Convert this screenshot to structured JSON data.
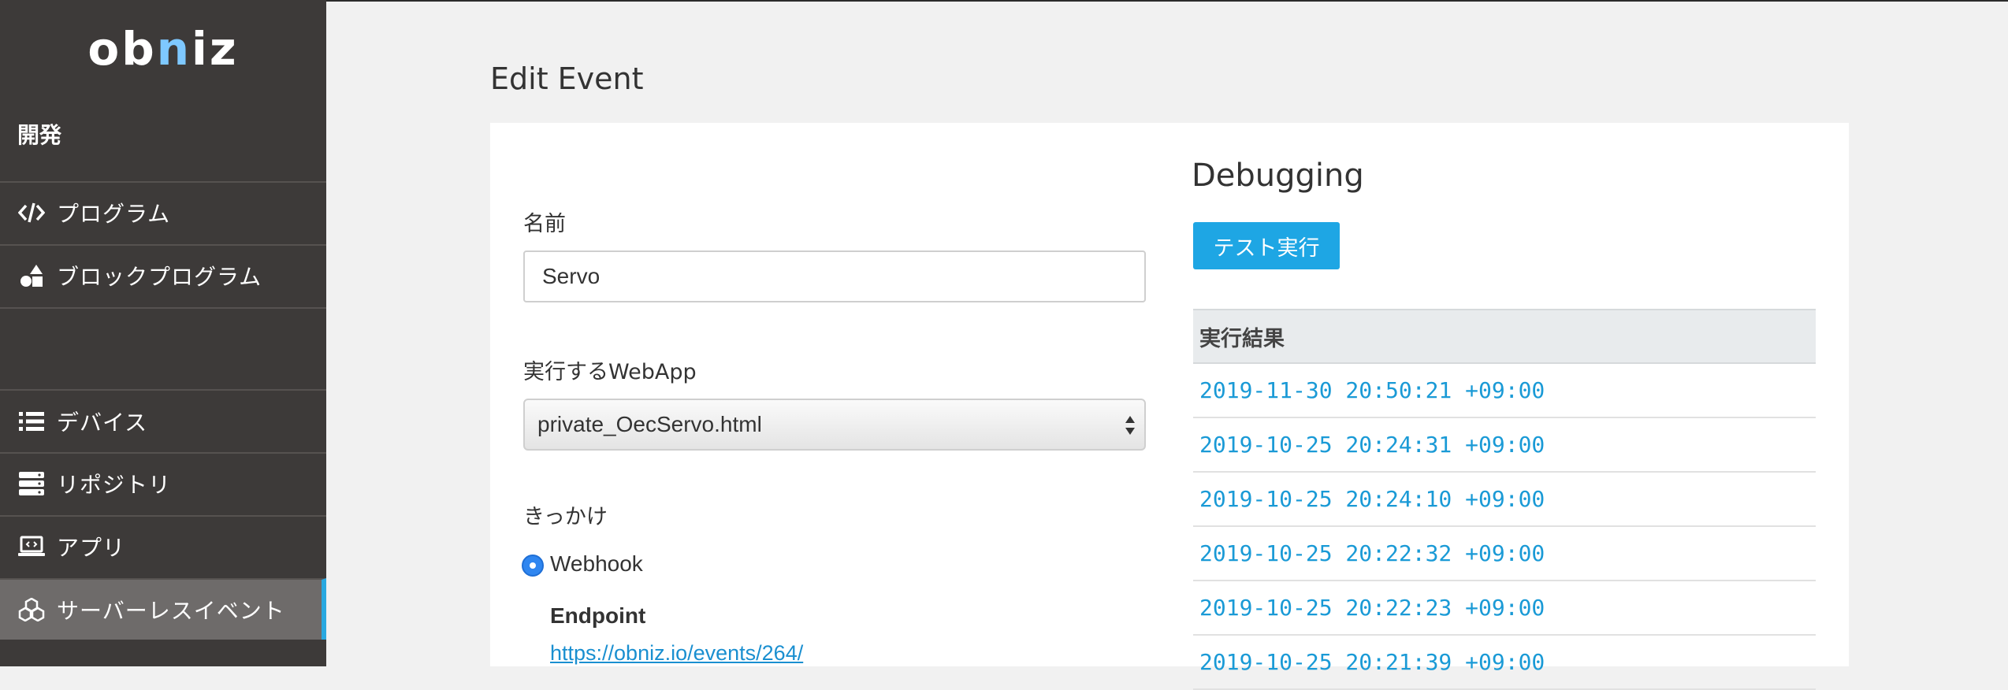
{
  "sidebar": {
    "logo": {
      "part1": "ob",
      "accent": "n",
      "part2": "iz"
    },
    "section_title": "開発",
    "items": [
      {
        "label": "プログラム",
        "icon": "code-icon"
      },
      {
        "label": "ブロックプログラム",
        "icon": "shapes-icon"
      },
      {
        "label": "デバイス",
        "icon": "list-icon"
      },
      {
        "label": "リポジトリ",
        "icon": "server-icon"
      },
      {
        "label": "アプリ",
        "icon": "laptop-icon"
      },
      {
        "label": "サーバーレスイベント",
        "icon": "cubes-icon",
        "active": true
      }
    ],
    "active_color": "#29a8e0"
  },
  "main": {
    "page_title": "Edit Event",
    "form": {
      "name_label": "名前",
      "name_value": "Servo",
      "webapp_label": "実行するWebApp",
      "webapp_value": "private_OecServo.html",
      "trigger_label": "きっかけ",
      "trigger_option": "Webhook",
      "endpoint_label": "Endpoint",
      "endpoint_url": "https://obniz.io/events/264/"
    },
    "debugging": {
      "title": "Debugging",
      "test_button": "テスト実行",
      "results_header": "実行結果",
      "results": [
        "2019-11-30 20:50:21 +09:00",
        "2019-10-25 20:24:31 +09:00",
        "2019-10-25 20:24:10 +09:00",
        "2019-10-25 20:22:32 +09:00",
        "2019-10-25 20:22:23 +09:00",
        "2019-10-25 20:21:39 +09:00"
      ]
    }
  },
  "colors": {
    "sidebar_bg": "#3d3a39",
    "accent": "#1ea6e4",
    "link": "#1a9ad6"
  }
}
